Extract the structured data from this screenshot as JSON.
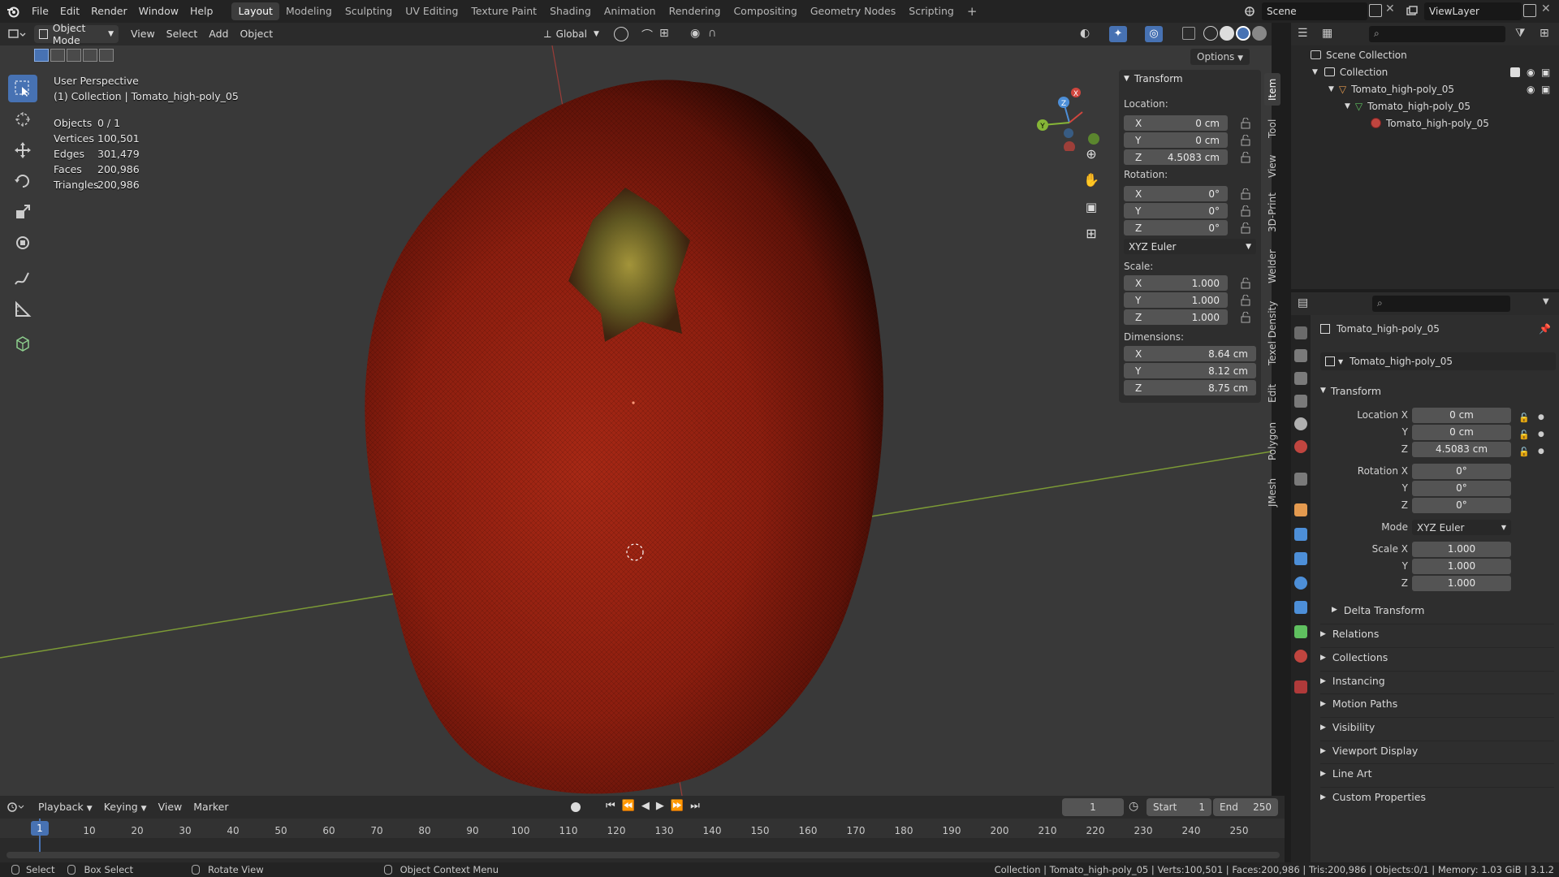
{
  "topbar": {
    "menus": [
      "File",
      "Edit",
      "Render",
      "Window",
      "Help"
    ],
    "workspaces": [
      "Layout",
      "Modeling",
      "Sculpting",
      "UV Editing",
      "Texture Paint",
      "Shading",
      "Animation",
      "Rendering",
      "Compositing",
      "Geometry Nodes",
      "Scripting"
    ],
    "active_workspace": "Layout",
    "add_tab": "+",
    "scene": "Scene",
    "view_layer": "ViewLayer"
  },
  "viewport_header": {
    "mode": "Object Mode",
    "menus": [
      "View",
      "Select",
      "Add",
      "Object"
    ],
    "orientation": "Global",
    "options": "Options"
  },
  "viewport": {
    "perspective": "User Perspective",
    "collection_line": "(1) Collection | Tomato_high-poly_05",
    "stats": [
      {
        "label": "Objects",
        "value": "0 / 1"
      },
      {
        "label": "Vertices",
        "value": "100,501"
      },
      {
        "label": "Edges",
        "value": "301,479"
      },
      {
        "label": "Faces",
        "value": "200,986"
      },
      {
        "label": "Triangles",
        "value": "200,986"
      }
    ],
    "gizmo_axes": {
      "x": "X",
      "y": "Y",
      "z": "Z"
    },
    "colors": {
      "bg": "#393939",
      "tomato": "#8a1c0e",
      "x_axis": "#d0463e",
      "y_axis": "#86b637",
      "z_axis": "#4d8fd8",
      "active": "#4772b3"
    }
  },
  "npanel": {
    "header": "Transform",
    "location_label": "Location:",
    "location": [
      {
        "axis": "X",
        "value": "0 cm"
      },
      {
        "axis": "Y",
        "value": "0 cm"
      },
      {
        "axis": "Z",
        "value": "4.5083 cm"
      }
    ],
    "rotation_label": "Rotation:",
    "rotation": [
      {
        "axis": "X",
        "value": "0°"
      },
      {
        "axis": "Y",
        "value": "0°"
      },
      {
        "axis": "Z",
        "value": "0°"
      }
    ],
    "rotation_mode": "XYZ Euler",
    "scale_label": "Scale:",
    "scale": [
      {
        "axis": "X",
        "value": "1.000"
      },
      {
        "axis": "Y",
        "value": "1.000"
      },
      {
        "axis": "Z",
        "value": "1.000"
      }
    ],
    "dimensions_label": "Dimensions:",
    "dimensions": [
      {
        "axis": "X",
        "value": "8.64 cm"
      },
      {
        "axis": "Y",
        "value": "8.12 cm"
      },
      {
        "axis": "Z",
        "value": "8.75 cm"
      }
    ],
    "tabs": [
      "Item",
      "Tool",
      "View",
      "3D-Print",
      "Welder",
      "Texel Density",
      "Edit",
      "Polygon",
      "JMesh"
    ]
  },
  "timeline": {
    "menus": [
      "Playback",
      "Keying",
      "View",
      "Marker"
    ],
    "current_frame": "1",
    "start_label": "Start",
    "start": "1",
    "end_label": "End",
    "end": "250",
    "ticks": [
      "1",
      "10",
      "20",
      "30",
      "40",
      "50",
      "60",
      "70",
      "80",
      "90",
      "100",
      "110",
      "120",
      "130",
      "140",
      "150",
      "160",
      "170",
      "180",
      "190",
      "200",
      "210",
      "220",
      "230",
      "240",
      "250"
    ]
  },
  "statusbar": {
    "select": "Select",
    "box_select": "Box Select",
    "rotate_view": "Rotate View",
    "context_menu": "Object Context Menu",
    "info": "Collection | Tomato_high-poly_05 | Verts:100,501 | Faces:200,986 | Tris:200,986 | Objects:0/1 | Memory: 1.03 GiB | 3.1.2"
  },
  "outliner": {
    "rows": [
      {
        "label": "Scene Collection",
        "indent": 0
      },
      {
        "label": "Collection",
        "indent": 1
      },
      {
        "label": "Tomato_high-poly_05",
        "indent": 2
      },
      {
        "label": "Tomato_high-poly_05",
        "indent": 3
      },
      {
        "label": "Tomato_high-poly_05",
        "indent": 4
      }
    ]
  },
  "properties": {
    "object_name": "Tomato_high-poly_05",
    "datablock": "Tomato_high-poly_05",
    "transform_header": "Transform",
    "location_x_label": "Location X",
    "y_label": "Y",
    "z_label": "Z",
    "location": [
      "0 cm",
      "0 cm",
      "4.5083 cm"
    ],
    "rotation_x_label": "Rotation X",
    "rotation": [
      "0°",
      "0°",
      "0°"
    ],
    "mode_label": "Mode",
    "mode": "XYZ Euler",
    "scale_x_label": "Scale X",
    "scale": [
      "1.000",
      "1.000",
      "1.000"
    ],
    "delta": "Delta Transform",
    "sections": [
      "Relations",
      "Collections",
      "Instancing",
      "Motion Paths",
      "Visibility",
      "Viewport Display",
      "Line Art",
      "Custom Properties"
    ]
  }
}
